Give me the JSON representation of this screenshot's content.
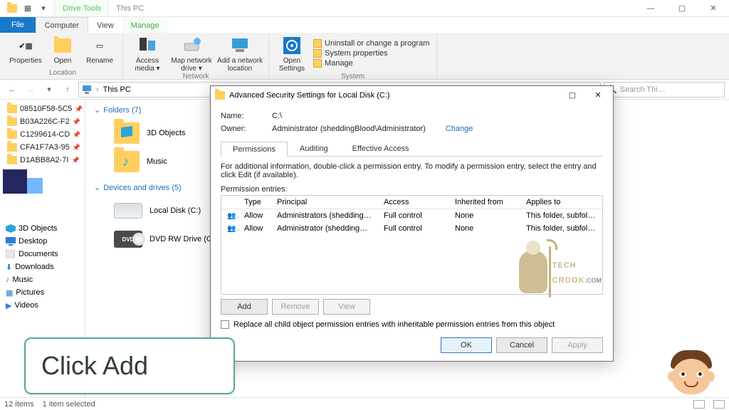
{
  "qat": {
    "drive_tools": "Drive Tools",
    "context_title": "This PC"
  },
  "window_controls": {
    "min": "—",
    "max": "▢",
    "close": "✕"
  },
  "ribbon_tabs": {
    "file": "File",
    "computer": "Computer",
    "view": "View",
    "manage": "Manage"
  },
  "ribbon": {
    "location": {
      "properties": "Properties",
      "open": "Open",
      "rename": "Rename",
      "group": "Location"
    },
    "network": {
      "access_media": "Access media ▾",
      "map_drive": "Map network drive ▾",
      "add_location": "Add a network location",
      "group": "Network"
    },
    "system": {
      "open_settings": "Open Settings",
      "uninstall": "Uninstall or change a program",
      "sys_props": "System properties",
      "manage": "Manage",
      "group": "System"
    }
  },
  "addr": {
    "crumb1": "This PC",
    "refresh": "⟳",
    "search_placeholder": "Search Thi…",
    "search_icon": "🔍"
  },
  "nav": {
    "recent": [
      "08510F58-5C5",
      "B03A226C-F2",
      "C1299614-CD",
      "CFA1F7A3-95",
      "D1ABB8A2-7I"
    ],
    "libs": [
      "3D Objects",
      "Desktop",
      "Documents",
      "Downloads",
      "Music",
      "Pictures",
      "Videos"
    ]
  },
  "content": {
    "folders_head": "Folders (7)",
    "folders": [
      "3D Objects",
      "Music"
    ],
    "drives_head": "Devices and drives (5)",
    "drives": [
      "Local Disk (C:)",
      "DVD RW Drive (G:)"
    ]
  },
  "dialog": {
    "title": "Advanced Security Settings for Local Disk (C:)",
    "name_k": "Name:",
    "name_v": "C:\\",
    "owner_k": "Owner:",
    "owner_v": "Administrator (sheddingBlood\\Administrator)",
    "owner_change": "Change",
    "tabs": {
      "perm": "Permissions",
      "audit": "Auditing",
      "eff": "Effective Access"
    },
    "hint": "For additional information, double-click a permission entry. To modify a permission entry, select the entry and click Edit (if available).",
    "entries_label": "Permission entries:",
    "cols": {
      "type": "Type",
      "principal": "Principal",
      "access": "Access",
      "inh": "Inherited from",
      "app": "Applies to"
    },
    "rows": [
      {
        "type": "Allow",
        "principal": "Administrators (sheddingBloo…",
        "access": "Full control",
        "inh": "None",
        "app": "This folder, subfolders and files"
      },
      {
        "type": "Allow",
        "principal": "Administrator (sheddingBloo…",
        "access": "Full control",
        "inh": "None",
        "app": "This folder, subfolders and files"
      }
    ],
    "buttons": {
      "add": "Add",
      "remove": "Remove",
      "view": "View"
    },
    "replace_chk": "Replace all child object permission entries with inheritable permission entries from this object",
    "footer": {
      "ok": "OK",
      "cancel": "Cancel",
      "apply": "Apply"
    }
  },
  "watermark": {
    "line1": "TECH",
    "line2": "CROOK",
    "suffix": ".COM"
  },
  "callout": "Click Add",
  "status": {
    "items": "12 items",
    "selected": "1 item selected"
  }
}
